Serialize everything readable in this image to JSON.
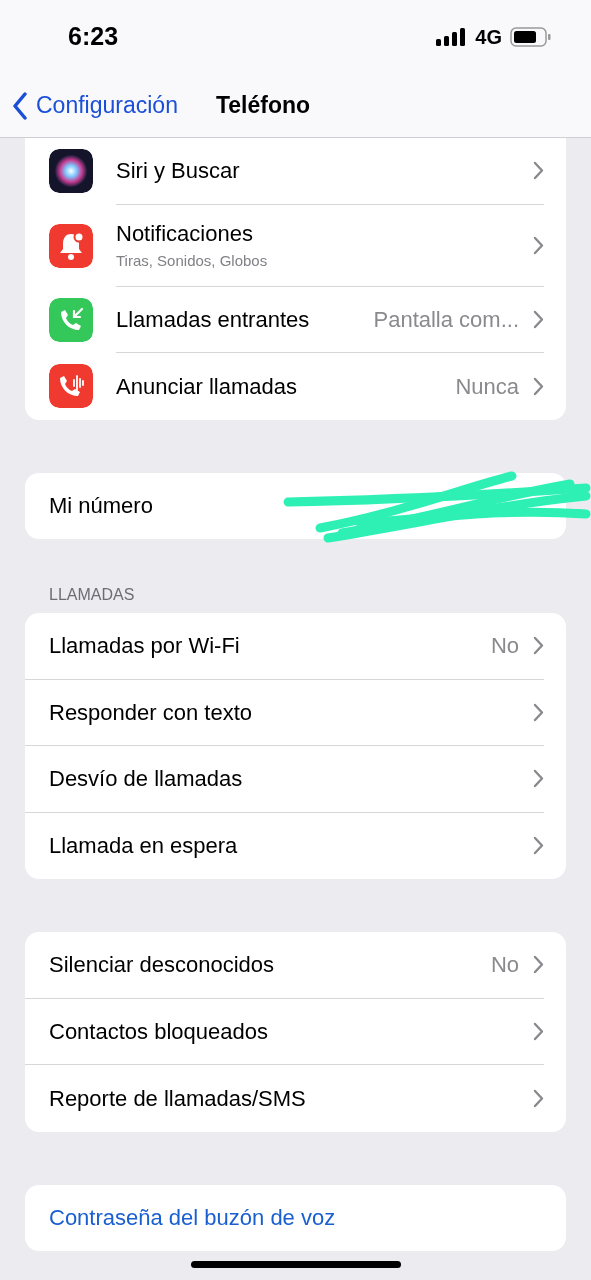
{
  "status_bar": {
    "time": "6:23",
    "network": "4G"
  },
  "nav": {
    "back": "Configuración",
    "title": "Teléfono"
  },
  "sections": [
    {
      "rows": [
        {
          "kind": "icon",
          "label": "Siri y Buscar",
          "chevron": true
        },
        {
          "kind": "icon",
          "label": "Notificaciones",
          "subtitle": "Tiras, Sonidos, Globos",
          "chevron": true
        },
        {
          "kind": "icon",
          "label": "Llamadas entrantes",
          "value": "Pantalla com...",
          "chevron": true
        },
        {
          "kind": "icon",
          "label": "Anunciar llamadas",
          "value": "Nunca",
          "chevron": true
        }
      ]
    },
    {
      "rows": [
        {
          "kind": "plain",
          "label": "Mi número",
          "chevron": false,
          "redacted": true
        }
      ]
    },
    {
      "header": "LLAMADAS",
      "rows": [
        {
          "kind": "plain",
          "label": "Llamadas por Wi-Fi",
          "value": "No",
          "chevron": true
        },
        {
          "kind": "plain",
          "label": "Responder con texto",
          "chevron": true
        },
        {
          "kind": "plain",
          "label": "Desvío de llamadas",
          "chevron": true
        },
        {
          "kind": "plain",
          "label": "Llamada en espera",
          "chevron": true
        }
      ]
    },
    {
      "rows": [
        {
          "kind": "plain",
          "label": "Silenciar desconocidos",
          "value": "No",
          "chevron": true
        },
        {
          "kind": "plain",
          "label": "Contactos bloqueados",
          "chevron": true
        },
        {
          "kind": "plain",
          "label": "Reporte de llamadas/SMS",
          "chevron": true
        }
      ]
    },
    {
      "rows": [
        {
          "kind": "link",
          "label": "Contraseña del buzón de voz",
          "chevron": false
        }
      ]
    }
  ]
}
